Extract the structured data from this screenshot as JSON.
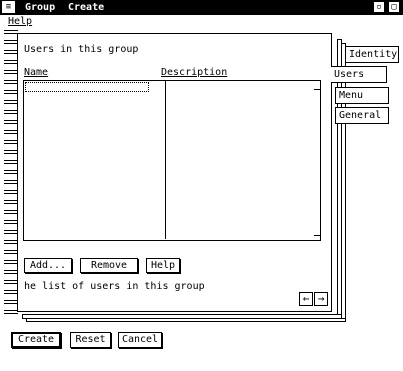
{
  "window": {
    "system_menu_glyph": "≡",
    "title": "Group",
    "title_action": "Create",
    "minimize_glyph": "▫",
    "maximize_glyph": "▢"
  },
  "menu": {
    "help": "Help"
  },
  "notebook": {
    "heading": "Users in this group",
    "columns": {
      "name": "Name",
      "description": "Description"
    },
    "buttons": {
      "add": "Add...",
      "remove": "Remove",
      "help": "Help"
    },
    "status": "he list of users in this group",
    "nav": {
      "prev": "←",
      "next": "→"
    },
    "tabs": [
      "Identity",
      "Users",
      "Menu",
      "General"
    ]
  },
  "footer": {
    "create": "Create",
    "reset": "Reset",
    "cancel": "Cancel"
  }
}
